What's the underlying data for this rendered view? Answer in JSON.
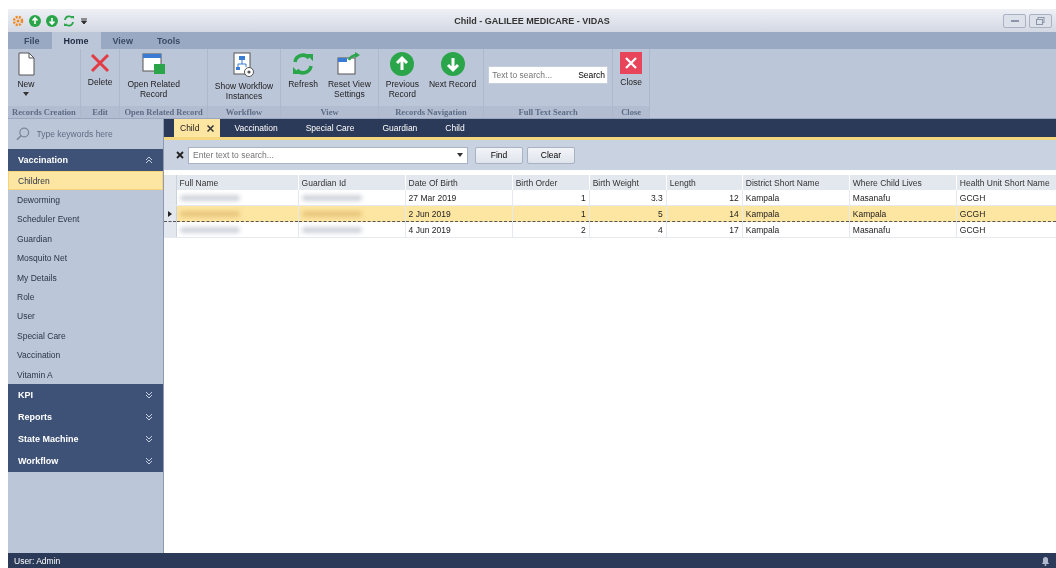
{
  "window": {
    "title": "Child - GALILEE MEDICARE - VIDAS"
  },
  "quick_access": [
    {
      "kind": "up"
    },
    {
      "kind": "down"
    },
    {
      "kind": "refresh"
    },
    {
      "kind": "more"
    }
  ],
  "menu_tabs": [
    {
      "label": "File",
      "selected": false
    },
    {
      "label": "Home",
      "selected": true
    },
    {
      "label": "View",
      "selected": false
    },
    {
      "label": "Tools",
      "selected": false
    }
  ],
  "ribbon_groups": [
    {
      "label": "Records Creation",
      "items": [
        {
          "kind": "new",
          "label": "New",
          "dropdown": true
        }
      ]
    },
    {
      "label": "Edit",
      "items": [
        {
          "kind": "delete",
          "label": "Delete",
          "dropdown": false
        }
      ]
    },
    {
      "label": "Open Related Record",
      "items": [
        {
          "kind": "related",
          "label": "Open Related\nRecord",
          "dropdown": false
        }
      ]
    },
    {
      "label": "Workflow",
      "items": [
        {
          "kind": "workflow",
          "label": "Show Workflow\nInstances",
          "dropdown": false
        }
      ]
    },
    {
      "label": "View",
      "items": [
        {
          "kind": "refresh",
          "label": "Refresh",
          "dropdown": false
        },
        {
          "kind": "reset",
          "label": "Reset View\nSettings",
          "dropdown": false
        }
      ]
    },
    {
      "label": "Records Navigation",
      "items": [
        {
          "kind": "previous",
          "label": "Previous\nRecord",
          "dropdown": false
        },
        {
          "kind": "next",
          "label": "Next Record",
          "dropdown": false
        }
      ]
    },
    {
      "label": "Full Text Search",
      "items": [
        {
          "kind": "search",
          "placeholder": "Text to search...",
          "label": "Search"
        }
      ]
    },
    {
      "label": "Close",
      "items": [
        {
          "kind": "close",
          "label": "Close",
          "dropdown": false
        }
      ]
    }
  ],
  "sidebar": {
    "search_placeholder": "Type keywords here",
    "groups": [
      {
        "title": "Vaccination",
        "expanded": true,
        "items": [
          {
            "label": "Children",
            "selected": true
          },
          {
            "label": "Deworming",
            "selected": false
          },
          {
            "label": "Scheduler Event",
            "selected": false
          },
          {
            "label": "Guardian",
            "selected": false
          },
          {
            "label": "Mosquito Net",
            "selected": false
          },
          {
            "label": "My Details",
            "selected": false
          },
          {
            "label": "Role",
            "selected": false
          },
          {
            "label": "User",
            "selected": false
          },
          {
            "label": "Special Care",
            "selected": false
          },
          {
            "label": "Vaccination",
            "selected": false
          },
          {
            "label": "Vitamin A",
            "selected": false
          }
        ]
      },
      {
        "title": "KPI",
        "expanded": false
      },
      {
        "title": "Reports",
        "expanded": false
      },
      {
        "title": "State Machine",
        "expanded": false
      },
      {
        "title": "Workflow",
        "expanded": false
      }
    ]
  },
  "doc_tabs": [
    {
      "label": "Child",
      "selected": true,
      "closable": true
    },
    {
      "label": "Vaccination",
      "selected": false,
      "closable": false
    },
    {
      "label": "Special Care",
      "selected": false,
      "closable": false
    },
    {
      "label": "Guardian",
      "selected": false,
      "closable": false
    },
    {
      "label": "Child",
      "selected": false,
      "closable": false
    }
  ],
  "find_panel": {
    "placeholder": "Enter text to search...",
    "find": "Find",
    "clear": "Clear"
  },
  "table": {
    "columns": [
      {
        "label": "Full Name",
        "kind": "text"
      },
      {
        "label": "Guardian Id",
        "kind": "text"
      },
      {
        "label": "Date Of Birth",
        "kind": "text"
      },
      {
        "label": "Birth Order",
        "kind": "number"
      },
      {
        "label": "Birth Weight",
        "kind": "number"
      },
      {
        "label": "Length",
        "kind": "number"
      },
      {
        "label": "District Short Name",
        "kind": "text"
      },
      {
        "label": "Where Child Lives",
        "kind": "text"
      },
      {
        "label": "Health Unit Short Name",
        "kind": "text"
      }
    ],
    "rows": [
      {
        "selected": false,
        "redacted": [
          true,
          true
        ],
        "cells": [
          "",
          "",
          "27 Mar 2019",
          "1",
          "3.3",
          "12",
          "Kampala",
          "Masanafu",
          "GCGH"
        ]
      },
      {
        "selected": true,
        "redacted": [
          true,
          true
        ],
        "cells": [
          "",
          "",
          "2 Jun 2019",
          "1",
          "5",
          "14",
          "Kampala",
          "Kampala",
          "GCGH"
        ]
      },
      {
        "selected": false,
        "redacted": [
          true,
          true
        ],
        "cells": [
          "",
          "",
          "4 Jun 2019",
          "2",
          "4",
          "17",
          "Kampala",
          "Masanafu",
          "GCGH"
        ]
      }
    ]
  },
  "status_bar": {
    "user": "User: Admin"
  }
}
